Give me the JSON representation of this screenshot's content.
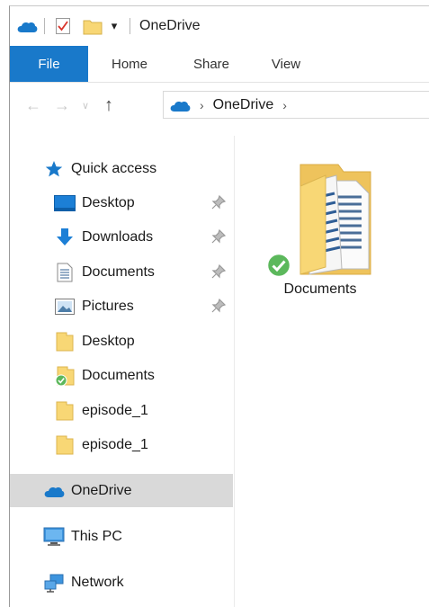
{
  "titlebar": {
    "title": "OneDrive",
    "qat_dropdown_glyph": "▾"
  },
  "ribbon": {
    "tabs": [
      {
        "label": "File",
        "active": true
      },
      {
        "label": "Home"
      },
      {
        "label": "Share"
      },
      {
        "label": "View"
      }
    ]
  },
  "navigation": {
    "back_glyph": "←",
    "forward_glyph": "→",
    "recent_glyph": "∨",
    "up_glyph": "↑",
    "breadcrumb": {
      "separator": "›",
      "location": "OneDrive"
    }
  },
  "navpane": {
    "quick_access": {
      "label": "Quick access",
      "icon": "star-icon"
    },
    "items": [
      {
        "label": "Desktop",
        "icon": "desktop-icon",
        "pinned": true
      },
      {
        "label": "Downloads",
        "icon": "download-arrow-icon",
        "pinned": true
      },
      {
        "label": "Documents",
        "icon": "document-icon",
        "pinned": true
      },
      {
        "label": "Pictures",
        "icon": "pictures-icon",
        "pinned": true
      },
      {
        "label": "Desktop",
        "icon": "folder-icon"
      },
      {
        "label": "Documents",
        "icon": "synced-folder-icon"
      },
      {
        "label": "episode_1",
        "icon": "folder-icon"
      },
      {
        "label": "episode_1",
        "icon": "folder-icon"
      }
    ],
    "onedrive": {
      "label": "OneDrive",
      "icon": "cloud-icon",
      "selected": true
    },
    "this_pc": {
      "label": "This PC",
      "icon": "monitor-icon"
    },
    "network": {
      "label": "Network",
      "icon": "network-icon"
    }
  },
  "content": {
    "items": [
      {
        "label": "Documents",
        "icon": "folder-with-documents-icon",
        "status": "synced"
      }
    ]
  },
  "colors": {
    "accent": "#1979ca",
    "folder": "#f8d775",
    "sync_ok": "#5cb85c",
    "selection": "#d9d9d9"
  }
}
